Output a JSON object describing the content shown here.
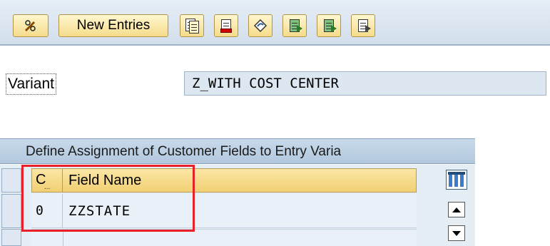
{
  "toolbar": {
    "new_entries_label": "New Entries",
    "icons": [
      "pencil-glasses-icon",
      "copy-icon",
      "delete-icon",
      "undo-icon",
      "select-all-icon",
      "select-block-icon",
      "deselect-icon"
    ]
  },
  "variant": {
    "label": "Variant",
    "value": "Z_WITH COST CENTER"
  },
  "table": {
    "title": "Define Assignment of Customer Fields to Entry Varia",
    "columns": [
      "C",
      "Field Name"
    ],
    "rows": [
      {
        "c": "0",
        "field_name": "ZZSTATE"
      }
    ]
  },
  "colors": {
    "annotation_box": "#e8202a",
    "header_gold": "#f1cf73",
    "panel_blue": "#b2c8de"
  }
}
